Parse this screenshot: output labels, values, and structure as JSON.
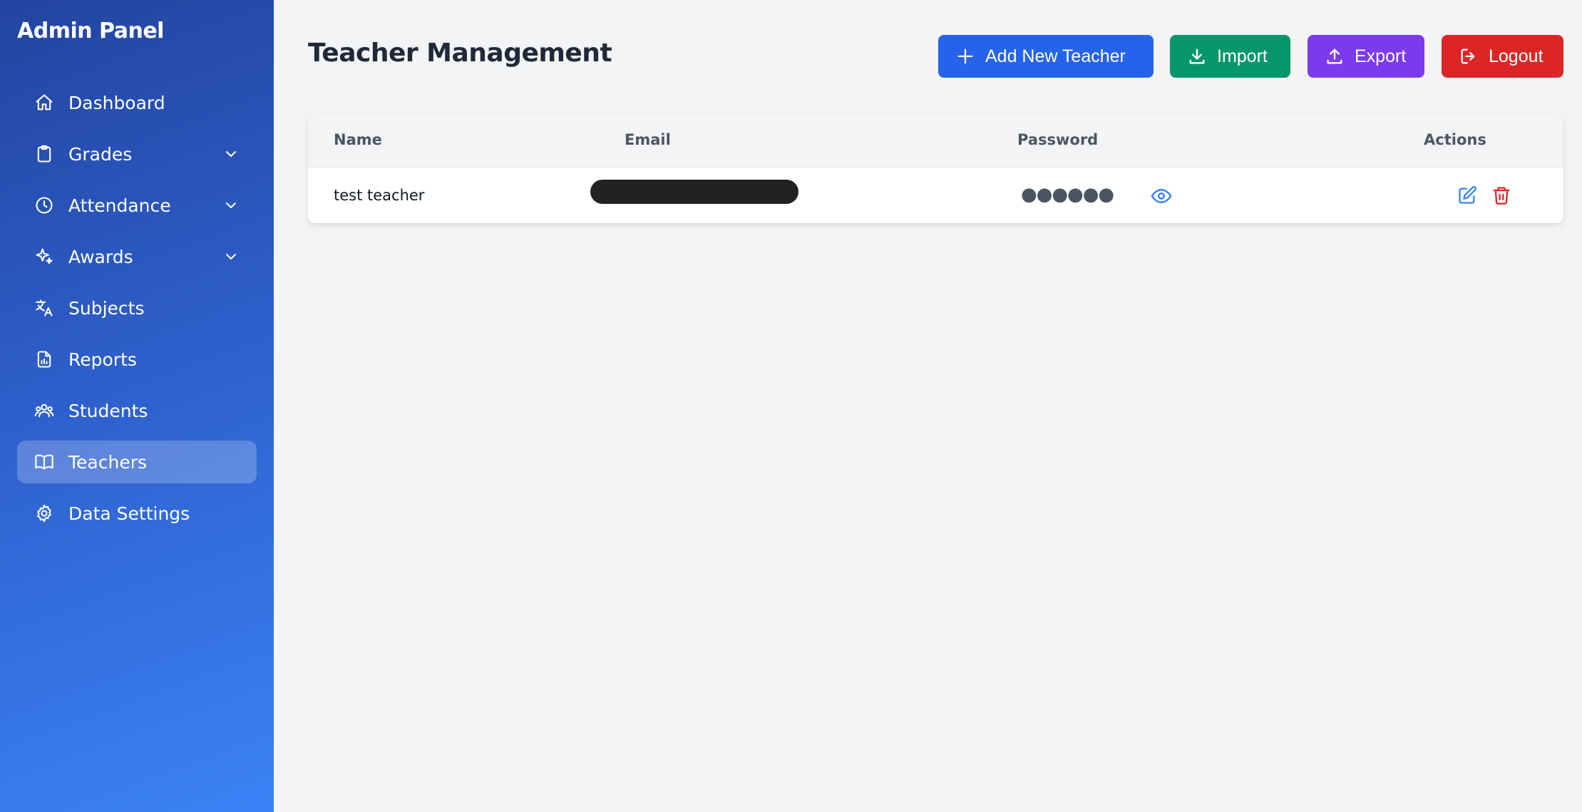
{
  "sidebar": {
    "brand": "Admin Panel",
    "items": [
      {
        "label": "Dashboard",
        "icon": "home-icon",
        "expandable": false
      },
      {
        "label": "Grades",
        "icon": "clipboard-icon",
        "expandable": true
      },
      {
        "label": "Attendance",
        "icon": "clock-icon",
        "expandable": true
      },
      {
        "label": "Awards",
        "icon": "sparkles-icon",
        "expandable": true
      },
      {
        "label": "Subjects",
        "icon": "translate-icon",
        "expandable": false
      },
      {
        "label": "Reports",
        "icon": "document-chart-icon",
        "expandable": false
      },
      {
        "label": "Students",
        "icon": "users-icon",
        "expandable": false
      },
      {
        "label": "Teachers",
        "icon": "book-icon",
        "expandable": false,
        "active": true
      },
      {
        "label": "Data Settings",
        "icon": "gear-icon",
        "expandable": false
      }
    ]
  },
  "header": {
    "title": "Teacher Management",
    "add_label": "Add New Teacher",
    "import_label": "Import",
    "export_label": "Export",
    "logout_label": "Logout"
  },
  "table": {
    "columns": [
      "Name",
      "Email",
      "Password",
      "Actions"
    ],
    "rows": [
      {
        "name": "test teacher",
        "email": "",
        "password_mask": "●●●●●●"
      }
    ]
  },
  "colors": {
    "add": "#2563eb",
    "import": "#059669",
    "export": "#7c3aed",
    "logout": "#dc2626",
    "sidebar_start": "#2344a0",
    "sidebar_end": "#3b82f6"
  }
}
